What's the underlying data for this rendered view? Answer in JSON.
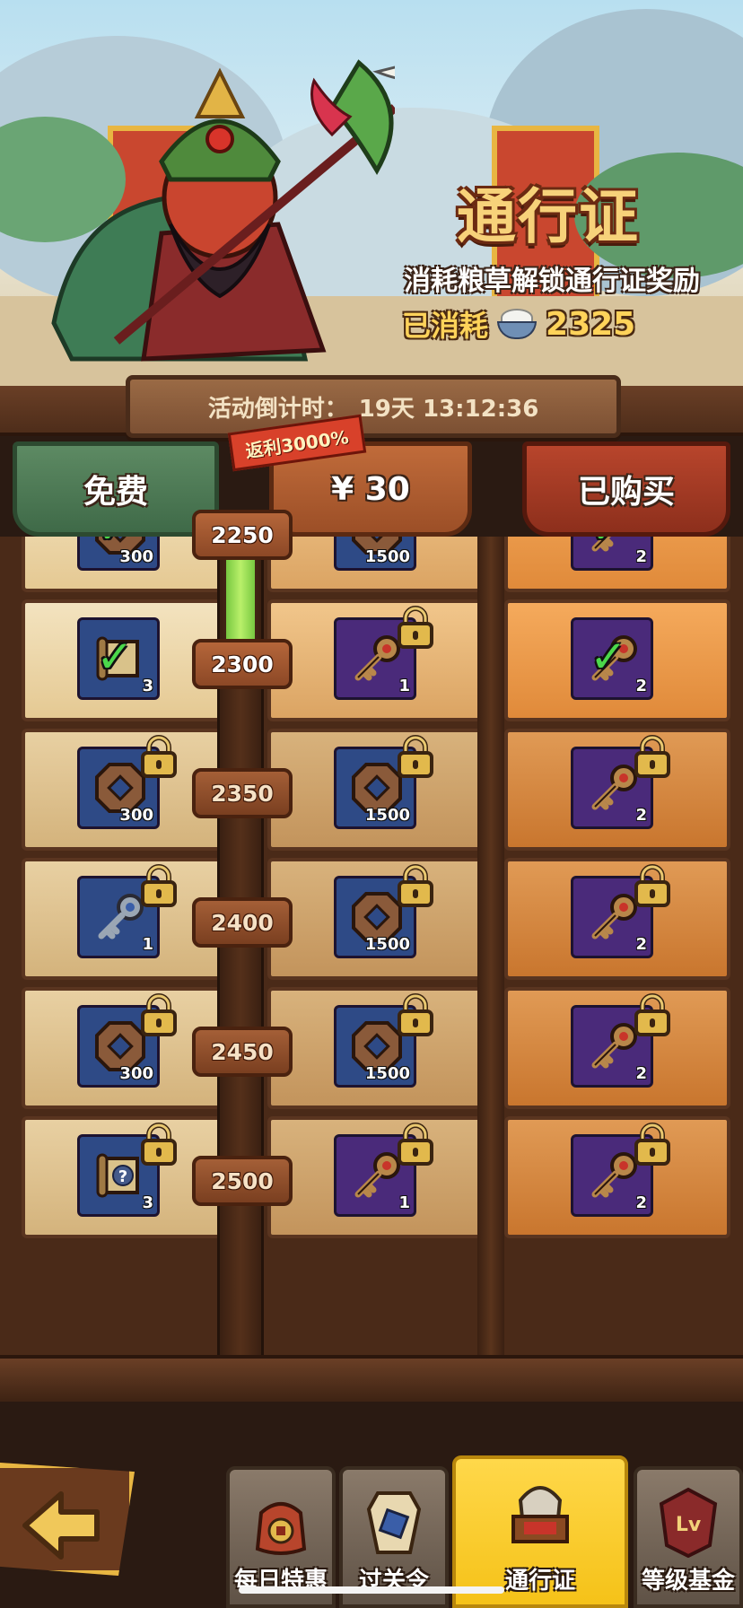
{
  "banner": {
    "title": "通行证",
    "subtitle": "消耗粮草解锁通行证奖励",
    "consumed_label": "已消耗",
    "consumed_value": "2325",
    "consumed_icon": "rice-bowl-icon"
  },
  "countdown": {
    "label": "活动倒计时：",
    "value": "19天 13:12:36"
  },
  "columns": {
    "free": "免费",
    "paid": "¥ 30",
    "bought": "已购买",
    "rebate": "返利3000%"
  },
  "rows": [
    {
      "level": "2250",
      "reached": true,
      "free": {
        "icon": "coin-icon",
        "qty": "300",
        "color": "blue",
        "claimed": true,
        "locked": false
      },
      "paid": {
        "icon": "coin-icon",
        "qty": "1500",
        "color": "blue",
        "claimed": false,
        "locked": false
      },
      "bought": {
        "icon": "key-icon",
        "qty": "2",
        "color": "purple",
        "claimed": true,
        "locked": false
      }
    },
    {
      "level": "2300",
      "reached": true,
      "free": {
        "icon": "scroll-icon",
        "qty": "3",
        "color": "blue",
        "claimed": true,
        "locked": false
      },
      "paid": {
        "icon": "key-icon",
        "qty": "1",
        "color": "purple",
        "claimed": false,
        "locked": true
      },
      "bought": {
        "icon": "key-icon",
        "qty": "2",
        "color": "purple",
        "claimed": true,
        "locked": false
      }
    },
    {
      "level": "2350",
      "reached": false,
      "free": {
        "icon": "coin-icon",
        "qty": "300",
        "color": "blue",
        "claimed": false,
        "locked": true
      },
      "paid": {
        "icon": "coin-icon",
        "qty": "1500",
        "color": "blue",
        "claimed": false,
        "locked": true
      },
      "bought": {
        "icon": "key-icon",
        "qty": "2",
        "color": "purple",
        "claimed": false,
        "locked": true
      }
    },
    {
      "level": "2400",
      "reached": false,
      "free": {
        "icon": "silver-key-icon",
        "qty": "1",
        "color": "blue",
        "claimed": false,
        "locked": true
      },
      "paid": {
        "icon": "coin-icon",
        "qty": "1500",
        "color": "blue",
        "claimed": false,
        "locked": true
      },
      "bought": {
        "icon": "key-icon",
        "qty": "2",
        "color": "purple",
        "claimed": false,
        "locked": true
      }
    },
    {
      "level": "2450",
      "reached": false,
      "free": {
        "icon": "coin-icon",
        "qty": "300",
        "color": "blue",
        "claimed": false,
        "locked": true
      },
      "paid": {
        "icon": "coin-icon",
        "qty": "1500",
        "color": "blue",
        "claimed": false,
        "locked": true
      },
      "bought": {
        "icon": "key-icon",
        "qty": "2",
        "color": "purple",
        "claimed": false,
        "locked": true
      }
    },
    {
      "level": "2500",
      "reached": false,
      "free": {
        "icon": "mystery-scroll-icon",
        "qty": "3",
        "color": "blue",
        "claimed": false,
        "locked": true
      },
      "paid": {
        "icon": "key-icon",
        "qty": "1",
        "color": "purple",
        "claimed": false,
        "locked": true
      },
      "bought": {
        "icon": "key-icon",
        "qty": "2",
        "color": "purple",
        "claimed": false,
        "locked": true
      }
    }
  ],
  "nav": {
    "back_icon": "back-arrow-icon",
    "tabs": [
      {
        "label": "每日特惠",
        "icon": "gift-bag-icon",
        "active": false
      },
      {
        "label": "过关令",
        "icon": "pass-token-icon",
        "active": false
      },
      {
        "label": "通行证",
        "icon": "supply-chest-icon",
        "active": true
      },
      {
        "label": "等级基金",
        "icon": "level-fund-icon",
        "active": false
      }
    ]
  },
  "colors": {
    "free_header": "#4f7a56",
    "paid_header": "#b0602f",
    "bought_header": "#a23c25",
    "active_tab": "#f5c218",
    "progress_fill": "#9be05a"
  }
}
